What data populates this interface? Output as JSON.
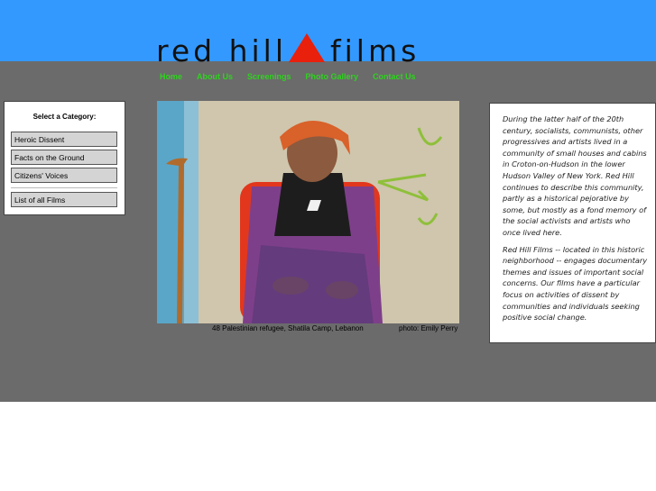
{
  "header": {
    "logo_left": "red hill",
    "logo_right": "films",
    "triangle_color": "#e8200c"
  },
  "nav": {
    "items": [
      "Home",
      "About Us",
      "Screenings",
      "Photo Gallery",
      "Contact Us"
    ]
  },
  "categories": {
    "title": "Select a Category:",
    "items": [
      "Heroic Dissent",
      "Facts on the Ground",
      "Citizens' Voices"
    ],
    "all_films": "List of all Films"
  },
  "photo": {
    "caption_left": "48 Palestinian refugee, Shatila Camp, Lebanon",
    "caption_right": "photo: Emily Perry"
  },
  "intro": {
    "p1": "During the latter half of the 20th century, socialists, communists, other progressives and artists lived in a community of small houses and cabins in Croton-on-Hudson in the lower Hudson Valley of New York. Red Hill continues to describe this community, partly as a historical pejorative by some, but mostly as a fond memory of the social activists and artists who once lived here.",
    "p2": "Red Hill Films -- located in this historic neighborhood -- engages documentary themes and issues of important social concerns. Our films have a particular focus on activities of dissent by communities and individuals seeking positive social change."
  },
  "colors": {
    "header_blue": "#3399ff",
    "body_gray": "#6b6b6b",
    "nav_green": "#2fd21f"
  }
}
